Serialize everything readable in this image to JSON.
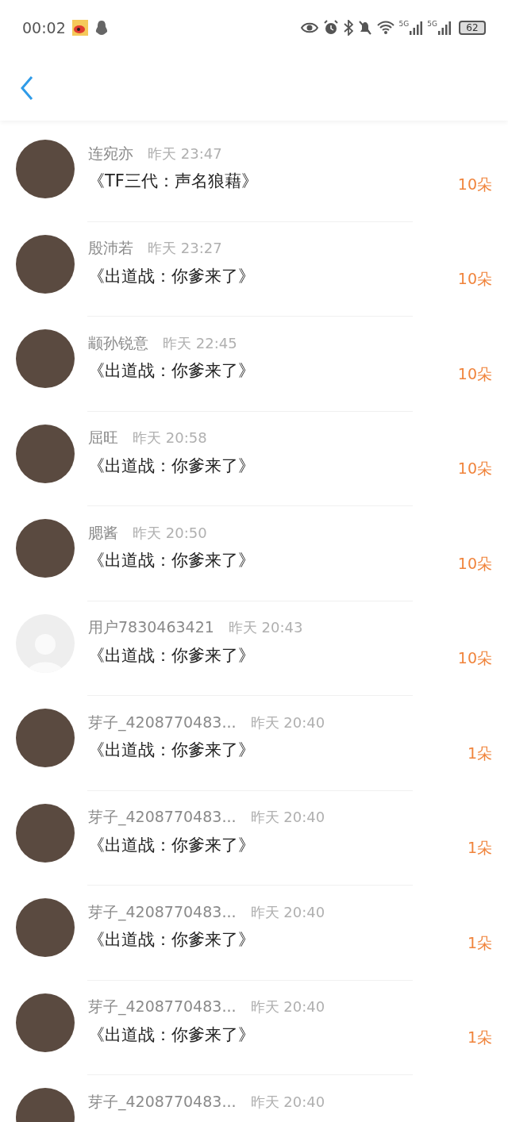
{
  "status_bar": {
    "time": "00:02",
    "network_labels": [
      "5G",
      "5G"
    ],
    "battery": "62"
  },
  "rows": [
    {
      "kind": "photo",
      "name": "连宛亦",
      "time": "昨天 23:47",
      "title": "《TF三代：声名狼藉》",
      "gift": "10朵"
    },
    {
      "kind": "photo",
      "name": "殷沛若",
      "time": "昨天 23:27",
      "title": "《出道战：你爹来了》",
      "gift": "10朵"
    },
    {
      "kind": "photo",
      "name": "颛孙锐意",
      "time": "昨天 22:45",
      "title": "《出道战：你爹来了》",
      "gift": "10朵"
    },
    {
      "kind": "photo",
      "name": "屈旺",
      "time": "昨天 20:58",
      "title": "《出道战：你爹来了》",
      "gift": "10朵"
    },
    {
      "kind": "photo",
      "name": "腮酱",
      "time": "昨天 20:50",
      "title": "《出道战：你爹来了》",
      "gift": "10朵"
    },
    {
      "kind": "default",
      "name": "用户7830463421",
      "time": "昨天 20:43",
      "title": "《出道战：你爹来了》",
      "gift": "10朵"
    },
    {
      "kind": "photo",
      "name": "芽子_4208770483...",
      "time": "昨天 20:40",
      "title": "《出道战：你爹来了》",
      "gift": "1朵"
    },
    {
      "kind": "photo",
      "name": "芽子_4208770483...",
      "time": "昨天 20:40",
      "title": "《出道战：你爹来了》",
      "gift": "1朵"
    },
    {
      "kind": "photo",
      "name": "芽子_4208770483...",
      "time": "昨天 20:40",
      "title": "《出道战：你爹来了》",
      "gift": "1朵"
    },
    {
      "kind": "photo",
      "name": "芽子_4208770483...",
      "time": "昨天 20:40",
      "title": "《出道战：你爹来了》",
      "gift": "1朵"
    },
    {
      "kind": "photo",
      "name": "芽子_4208770483...",
      "time": "昨天 20:40"
    }
  ]
}
